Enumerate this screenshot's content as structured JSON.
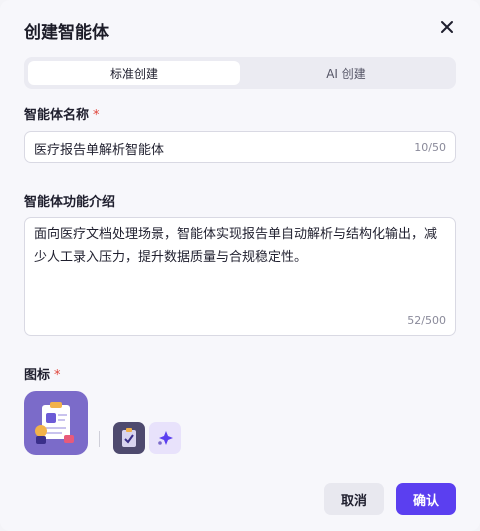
{
  "dialog": {
    "title": "创建智能体",
    "close_icon": "close-icon"
  },
  "tabs": [
    {
      "label": "标准创建",
      "active": true
    },
    {
      "label": "AI 创建",
      "active": false
    }
  ],
  "name_field": {
    "label": "智能体名称",
    "required_mark": "*",
    "value": "医疗报告单解析智能体",
    "counter": "10/50"
  },
  "desc_field": {
    "label": "智能体功能介绍",
    "value": "面向医疗文档处理场景，智能体实现报告单自动解析与结构化输出，减少人工录入压力，提升数据质量与合规稳定性。",
    "counter": "52/500"
  },
  "icon_field": {
    "label": "图标",
    "required_mark": "*",
    "main_icon": "medical-report-icon",
    "options": [
      "clipboard-check-icon",
      "sparkle-icon"
    ]
  },
  "footer": {
    "cancel_label": "取消",
    "confirm_label": "确认"
  },
  "colors": {
    "primary": "#5b3ff0",
    "required": "#e0443a",
    "icon_bg": "#7b6bc9"
  }
}
